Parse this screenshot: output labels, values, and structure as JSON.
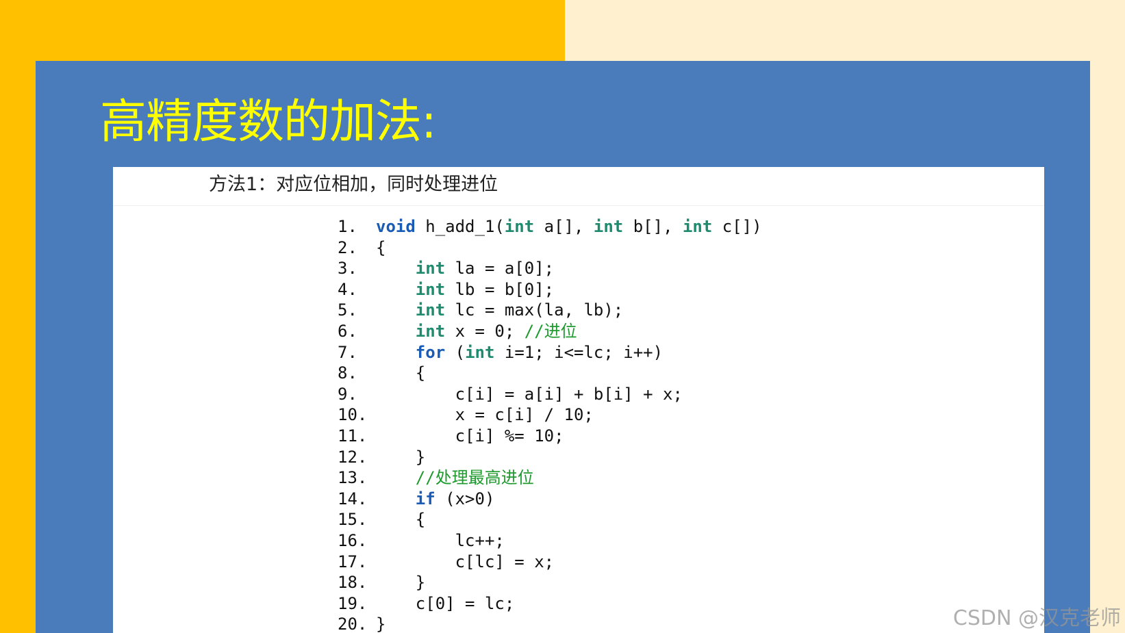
{
  "slide": {
    "title": "高精度数的加法:",
    "method": "方法1：对应位相加，同时处理进位"
  },
  "code": {
    "lines": [
      {
        "num": "1.",
        "segs": [
          {
            "t": "void",
            "c": "kw-blue"
          },
          {
            "t": " h_add_1(",
            "c": ""
          },
          {
            "t": "int",
            "c": "kw-green"
          },
          {
            "t": " a[], ",
            "c": ""
          },
          {
            "t": "int",
            "c": "kw-green"
          },
          {
            "t": " b[], ",
            "c": ""
          },
          {
            "t": "int",
            "c": "kw-green"
          },
          {
            "t": " c[])",
            "c": ""
          }
        ]
      },
      {
        "num": "2.",
        "segs": [
          {
            "t": "{",
            "c": ""
          }
        ]
      },
      {
        "num": "3.",
        "segs": [
          {
            "t": "    ",
            "c": ""
          },
          {
            "t": "int",
            "c": "kw-green"
          },
          {
            "t": " la = a[0];",
            "c": ""
          }
        ]
      },
      {
        "num": "4.",
        "segs": [
          {
            "t": "    ",
            "c": ""
          },
          {
            "t": "int",
            "c": "kw-green"
          },
          {
            "t": " lb = b[0];",
            "c": ""
          }
        ]
      },
      {
        "num": "5.",
        "segs": [
          {
            "t": "    ",
            "c": ""
          },
          {
            "t": "int",
            "c": "kw-green"
          },
          {
            "t": " lc = max(la, lb);",
            "c": ""
          }
        ]
      },
      {
        "num": "6.",
        "segs": [
          {
            "t": "    ",
            "c": ""
          },
          {
            "t": "int",
            "c": "kw-green"
          },
          {
            "t": " x = 0; ",
            "c": ""
          },
          {
            "t": "//进位",
            "c": "cm"
          }
        ]
      },
      {
        "num": "7.",
        "segs": [
          {
            "t": "    ",
            "c": ""
          },
          {
            "t": "for",
            "c": "kw-blue"
          },
          {
            "t": " (",
            "c": ""
          },
          {
            "t": "int",
            "c": "kw-green"
          },
          {
            "t": " i=1; i<=lc; i++)",
            "c": ""
          }
        ]
      },
      {
        "num": "8.",
        "segs": [
          {
            "t": "    {",
            "c": ""
          }
        ]
      },
      {
        "num": "9.",
        "segs": [
          {
            "t": "        c[i] = a[i] + b[i] + x;",
            "c": ""
          }
        ]
      },
      {
        "num": "10.",
        "segs": [
          {
            "t": "        x = c[i] / 10;",
            "c": ""
          }
        ]
      },
      {
        "num": "11.",
        "segs": [
          {
            "t": "        c[i] %= 10;",
            "c": ""
          }
        ]
      },
      {
        "num": "12.",
        "segs": [
          {
            "t": "    }",
            "c": ""
          }
        ]
      },
      {
        "num": "13.",
        "segs": [
          {
            "t": "    ",
            "c": ""
          },
          {
            "t": "//处理最高进位",
            "c": "cm"
          }
        ]
      },
      {
        "num": "14.",
        "segs": [
          {
            "t": "    ",
            "c": ""
          },
          {
            "t": "if",
            "c": "kw-blue"
          },
          {
            "t": " (x>0)",
            "c": ""
          }
        ]
      },
      {
        "num": "15.",
        "segs": [
          {
            "t": "    {",
            "c": ""
          }
        ]
      },
      {
        "num": "16.",
        "segs": [
          {
            "t": "        lc++;",
            "c": ""
          }
        ]
      },
      {
        "num": "17.",
        "segs": [
          {
            "t": "        c[lc] = x;",
            "c": ""
          }
        ]
      },
      {
        "num": "18.",
        "segs": [
          {
            "t": "    }",
            "c": ""
          }
        ]
      },
      {
        "num": "19.",
        "segs": [
          {
            "t": "    c[0] = lc;",
            "c": ""
          }
        ]
      },
      {
        "num": "20.",
        "segs": [
          {
            "t": "}",
            "c": ""
          }
        ]
      }
    ]
  },
  "watermark": "CSDN @汉克老师",
  "colors": {
    "background_cream": "#fff1cf",
    "accent_yellow": "#ffc000",
    "panel_blue": "#4a7cbc",
    "title_yellow": "#ffff00",
    "keyword_green": "#1e8a6e",
    "keyword_blue": "#1a5bb5",
    "comment_green": "#1e9a2e"
  }
}
